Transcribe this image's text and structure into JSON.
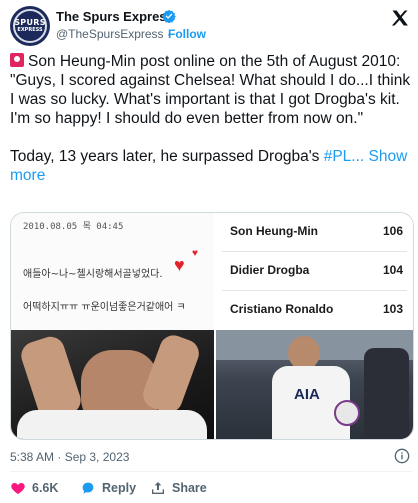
{
  "account": {
    "name": "The Spurs Express",
    "handle": "@TheSpursExpress",
    "follow_separator": "·",
    "follow_label": "Follow",
    "avatar_text_top": "SPURS",
    "avatar_text_bottom": "EXPRESS"
  },
  "tweet": {
    "line1": "Son Heung-Min post online on the 5th of August 2010:",
    "line2": "\"Guys, I scored against Chelsea! What should I do...I think I was so lucky. What's important is that I got Drogba's kit. I'm so happy! I should do even better from now on.\"",
    "line3_text": "Today, 13 years later, he surpassed Drogba's ",
    "hashtag": "#PL...",
    "show_more": "Show more"
  },
  "media": {
    "note": {
      "date": "2010.08.05 목 04:45",
      "line1": "애들아~나~첼시랑해서골넣었다.",
      "line2": "어떡하지ㅠㅠ ㅠ운이넘좋은거같애어 ㅋ"
    },
    "stats": [
      {
        "name": "Son Heung-Min",
        "value": "106"
      },
      {
        "name": "Didier Drogba",
        "value": "104"
      },
      {
        "name": "Cristiano Ronaldo",
        "value": "103"
      }
    ],
    "kit_text": "AIA"
  },
  "meta": {
    "timestamp": "5:38 AM · Sep 3, 2023"
  },
  "actions": {
    "likes": "6.6K",
    "reply": "Reply",
    "share": "Share"
  },
  "colors": {
    "link": "#1d9bf0",
    "like": "#f91880",
    "muted": "#536471",
    "verified": "#1d9bf0"
  }
}
